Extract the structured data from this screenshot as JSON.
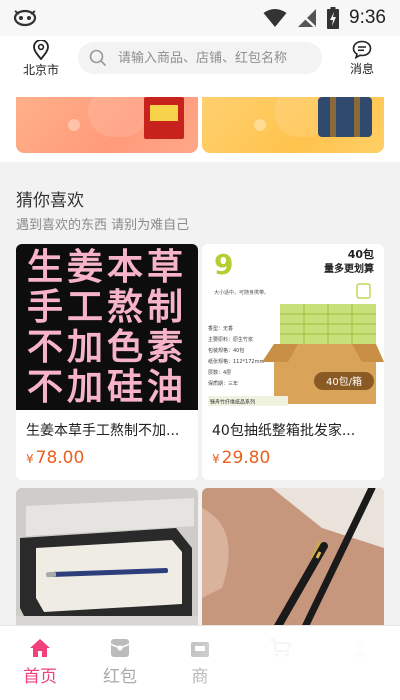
{
  "status_bar": {
    "time": "9:36"
  },
  "header": {
    "location": "北京市",
    "search_placeholder": "请输入商品、店铺、红包名称",
    "messages": "消息"
  },
  "recommend": {
    "title": "猜你喜欢",
    "subtitle": "遇到喜欢的东西 请别为难自己",
    "products": [
      {
        "title": "生姜本草手工熬制不加...",
        "currency": "¥",
        "price": "78.00",
        "image_text": [
          "生姜本草",
          "手工熬制",
          "不加色素",
          "不加硅油"
        ]
      },
      {
        "title": "40包抽纸整箱批发家...",
        "currency": "¥",
        "price": "29.80",
        "image_text": {
          "number": "9",
          "headline_1": "40包",
          "headline_2": "量多更划算",
          "tagline": "大小适中，可随身携带。",
          "specs": [
            "香型：无香",
            "主要原料：原生竹浆",
            "包装规格：40包",
            "纸张规格：112*172mm",
            "层数：4层",
            "保质期：三年"
          ],
          "box_label": "40包/箱",
          "series": "臻舟竹纤维纸品系列"
        }
      },
      {
        "title": "",
        "currency": "",
        "price": ""
      },
      {
        "title": "",
        "currency": "",
        "price": ""
      }
    ]
  },
  "tabbar": {
    "tabs": [
      {
        "label": "首页",
        "icon": "home-icon",
        "active": true
      },
      {
        "label": "红包",
        "icon": "red-packet-icon",
        "active": false
      },
      {
        "label": "商",
        "icon": "store-icon",
        "active": false
      },
      {
        "label": "",
        "icon": "cart-icon",
        "active": false
      },
      {
        "label": "",
        "icon": "user-icon",
        "active": false
      }
    ]
  },
  "colors": {
    "accent": "#f0417a",
    "price": "#e8621e",
    "banner_1": "#ffa47f",
    "banner_2": "#ffc759"
  }
}
